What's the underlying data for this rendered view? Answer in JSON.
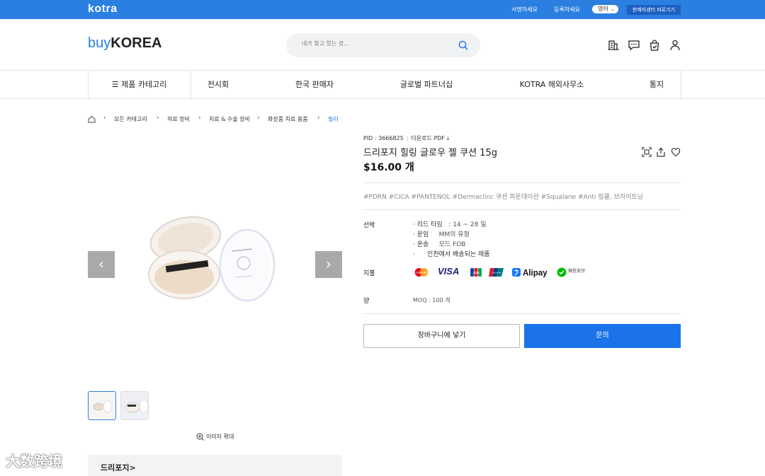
{
  "topbar": {
    "logo": "kotra",
    "links": [
      "서명하세요",
      "등록하세요"
    ],
    "language": "영어",
    "seller_center": "판매자센터 바로가기"
  },
  "header": {
    "logo_buy": "buy",
    "logo_korea": "KOREA",
    "search_placeholder": "내가 찾고 있는 것...",
    "icons": [
      "building-icon",
      "chat-icon",
      "bag-icon",
      "user-icon"
    ]
  },
  "nav": {
    "category": "제품 카테고리",
    "items": [
      "전시회",
      "한국 판매자",
      "글로벌 파트너십",
      "KOTRA 해외사무소",
      "통지"
    ]
  },
  "breadcrumb": [
    "모든 카테고리",
    "의료 장비",
    "치료 & 수술 장비",
    "화장품 치료 용품",
    "필러"
  ],
  "product": {
    "pid": "PID : 3666825",
    "download": "다운로드 PDF",
    "title": "드리포지 힐링 글로우 젤 쿠션 15g",
    "price": "$16.00 개",
    "tags": "#PDRN #CICA #PANTENOL #Dermaclinc 쿠션 파운데이션 #Squalane #Anti 링클, 브라이트닝",
    "shipping_label": "선박",
    "shipping": [
      {
        "k": "· 리드 타임",
        "v": ": 14 ~ 28 일"
      },
      {
        "k": "· 운임",
        "v": "MM의 유형"
      },
      {
        "k": "· 운송",
        "v": "모드 FOB"
      },
      {
        "k": "·",
        "v": "인천에서 배송되는 제품"
      }
    ],
    "payment_label": "지불",
    "payments": [
      "mastercard",
      "VISA",
      "JCB",
      "UnionPay",
      "Alipay",
      "微信支付"
    ],
    "qty_label": "양",
    "moq": "MOQ : 100 개",
    "cart_button": "장바구니에 넣기",
    "inquiry_button": "문의",
    "image_zoom": "이미지 확대",
    "brand_panel": "드리포지>",
    "watermark": "大数跨境"
  },
  "colors": {
    "primary": "#2a7fe0",
    "button": "#1a73e8"
  }
}
